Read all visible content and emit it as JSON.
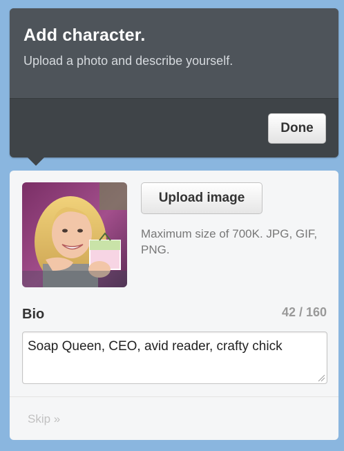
{
  "dialog": {
    "title": "Add character.",
    "subtitle": "Upload a photo and describe yourself.",
    "done_label": "Done"
  },
  "profile": {
    "upload_label": "Upload image",
    "upload_note": "Maximum size of 700K. JPG, GIF, PNG.",
    "bio_label": "Bio",
    "bio_counter": "42 / 160",
    "bio_text": "Soap Queen, CEO, avid reader, crafty chick",
    "skip_label": "Skip »"
  },
  "colors": {
    "page_background": "#8ab6df",
    "header_background": "#4e545a",
    "footer_background": "#3f4448",
    "card_background": "#f5f6f7"
  }
}
